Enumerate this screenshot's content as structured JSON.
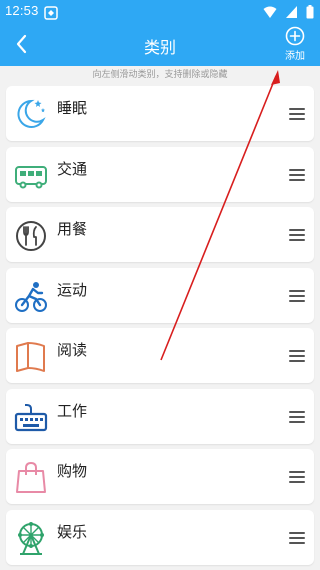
{
  "status_bar": {
    "time": "12:53",
    "icons": [
      "app-notification-icon",
      "wifi-icon",
      "signal-icon",
      "battery-icon"
    ]
  },
  "header": {
    "title": "类别",
    "back_icon": "back-arrow-icon",
    "add_icon": "plus-circle-icon",
    "add_label": "添加",
    "background": "#2ea8f4"
  },
  "hint": "向左侧滑动类别，支持删除或隐藏",
  "categories": [
    {
      "label": "睡眠",
      "icon": "moon-icon",
      "color": "#3aa6e8"
    },
    {
      "label": "交通",
      "icon": "bus-icon",
      "color": "#3fae7a"
    },
    {
      "label": "用餐",
      "icon": "fork-knife-icon",
      "color": "#444444"
    },
    {
      "label": "运动",
      "icon": "cyclist-icon",
      "color": "#1f6fc4"
    },
    {
      "label": "阅读",
      "icon": "book-icon",
      "color": "#e07a4e"
    },
    {
      "label": "工作",
      "icon": "keyboard-icon",
      "color": "#1e5aa8"
    },
    {
      "label": "购物",
      "icon": "shopping-bag-icon",
      "color": "#e88aa6"
    },
    {
      "label": "娱乐",
      "icon": "ferris-wheel-icon",
      "color": "#2fa36b"
    }
  ],
  "annotation": {
    "arrow_color": "#d81e1e"
  }
}
